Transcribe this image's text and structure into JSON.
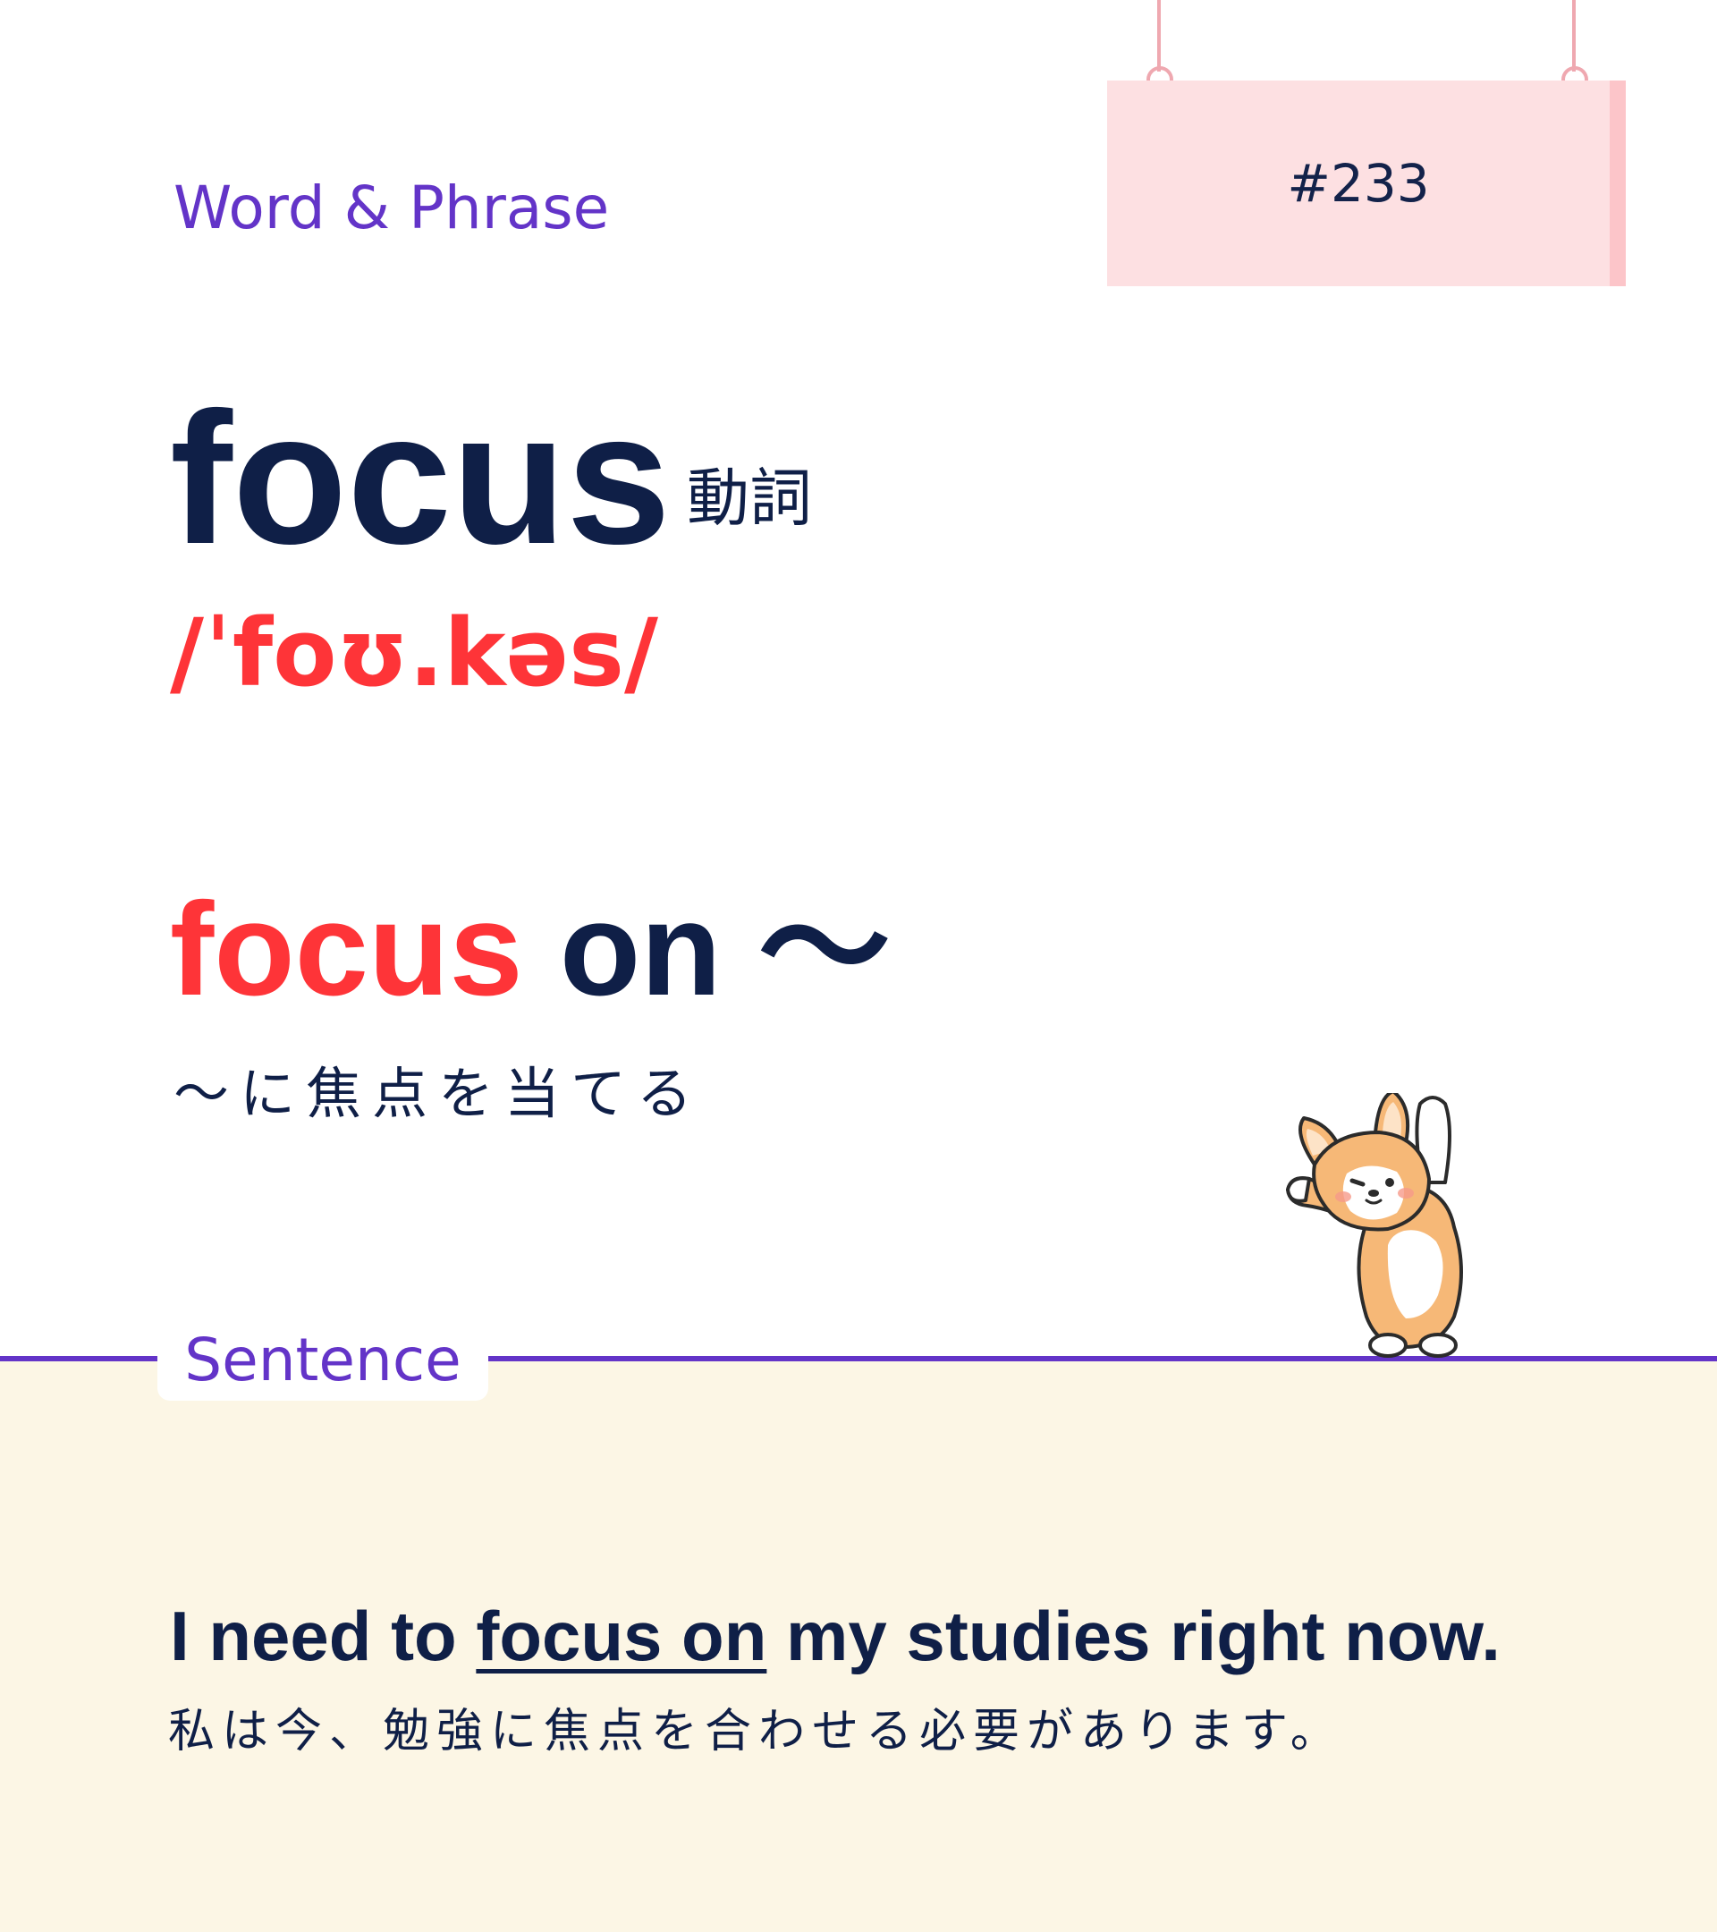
{
  "header": {
    "category": "Word & Phrase",
    "number": "#233"
  },
  "entry": {
    "word": "focus",
    "part_of_speech": "動詞",
    "pronunciation": "/ˈfoʊ.kəs/"
  },
  "phrase": {
    "highlight": "focus",
    "rest": " on ～",
    "meaning": "～に焦点を当てる"
  },
  "sentence_section": {
    "label": "Sentence",
    "english_before": "I need to ",
    "english_highlight": "focus on",
    "english_after": " my studies right now.",
    "japanese": "私は今、勉強に焦点を合わせる必要があります。"
  },
  "colors": {
    "navy": "#0f1f47",
    "red": "#fe3438",
    "purple": "#6334c8",
    "pink_sign": "#fde0e2",
    "cream": "#fcf6e5"
  },
  "illustration": {
    "icon": "corgi-mascot-icon"
  }
}
